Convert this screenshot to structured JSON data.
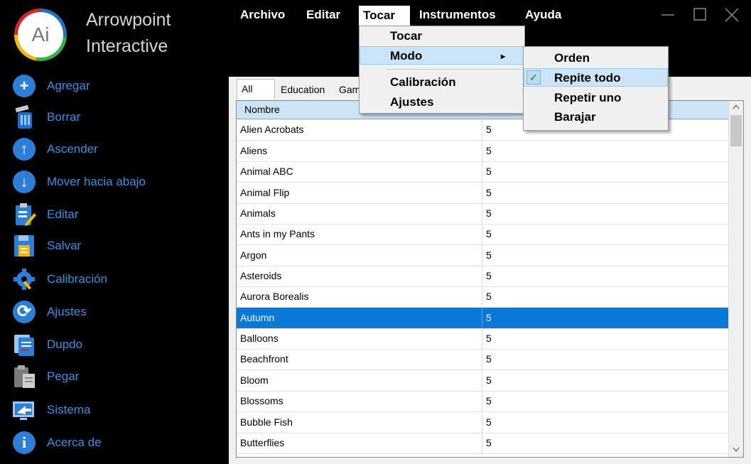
{
  "brand": {
    "line1": "Arrowpoint",
    "line2": "Interactive",
    "logo_text": "Ai"
  },
  "sidebar": {
    "items": [
      {
        "label": "Agregar",
        "icon": "add-icon"
      },
      {
        "label": "Borrar",
        "icon": "trash-icon"
      },
      {
        "label": "Ascender",
        "icon": "arrow-up-icon"
      },
      {
        "label": "Mover hacia abajo",
        "icon": "arrow-down-icon"
      },
      {
        "label": "Editar",
        "icon": "edit-clipboard-icon"
      },
      {
        "label": "Salvar",
        "icon": "save-icon"
      },
      {
        "label": "Calibración",
        "icon": "gear-wrench-icon"
      },
      {
        "label": "Ajustes",
        "icon": "refresh-icon"
      },
      {
        "label": "Dupdo",
        "icon": "copy-icon"
      },
      {
        "label": "Pegar",
        "icon": "paste-icon"
      },
      {
        "label": "Sistema",
        "icon": "system-icon"
      },
      {
        "label": "Acerca de",
        "icon": "info-icon"
      }
    ]
  },
  "menubar": {
    "items": [
      "Archivo",
      "Editar",
      "Tocar",
      "Instrumentos",
      "Ayuda"
    ],
    "open": "Tocar"
  },
  "tocar_menu": {
    "items": [
      "Tocar",
      "Modo",
      "Calibración",
      "Ajustes"
    ],
    "highlighted": "Modo",
    "submenu_arrow": "▸"
  },
  "modo_submenu": {
    "items": [
      "Orden",
      "Repite todo",
      "Repetir uno",
      "Barajar"
    ],
    "checked": "Repite todo",
    "check_glyph": "✓"
  },
  "tabs": [
    "All",
    "Education",
    "Gam"
  ],
  "table": {
    "columns": [
      "Nombre",
      ""
    ],
    "rows": [
      [
        "Alien Acrobats",
        "5"
      ],
      [
        "Aliens",
        "5"
      ],
      [
        "Animal ABC",
        "5"
      ],
      [
        "Animal Flip",
        "5"
      ],
      [
        "Animals",
        "5"
      ],
      [
        "Ants in my Pants",
        "5"
      ],
      [
        "Argon",
        "5"
      ],
      [
        "Asteroids",
        "5"
      ],
      [
        "Aurora Borealis",
        "5"
      ],
      [
        "Autumn",
        "5"
      ],
      [
        "Balloons",
        "5"
      ],
      [
        "Beachfront",
        "5"
      ],
      [
        "Bloom",
        "5"
      ],
      [
        "Blossoms",
        "5"
      ],
      [
        "Bubble Fish",
        "5"
      ],
      [
        "Butterflies",
        "5"
      ]
    ],
    "selected_row": "Autumn"
  },
  "colors": {
    "accent": "#0a78d7",
    "sidebar_text": "#3a8fe0",
    "menu_highlight": "#cce4f7"
  }
}
